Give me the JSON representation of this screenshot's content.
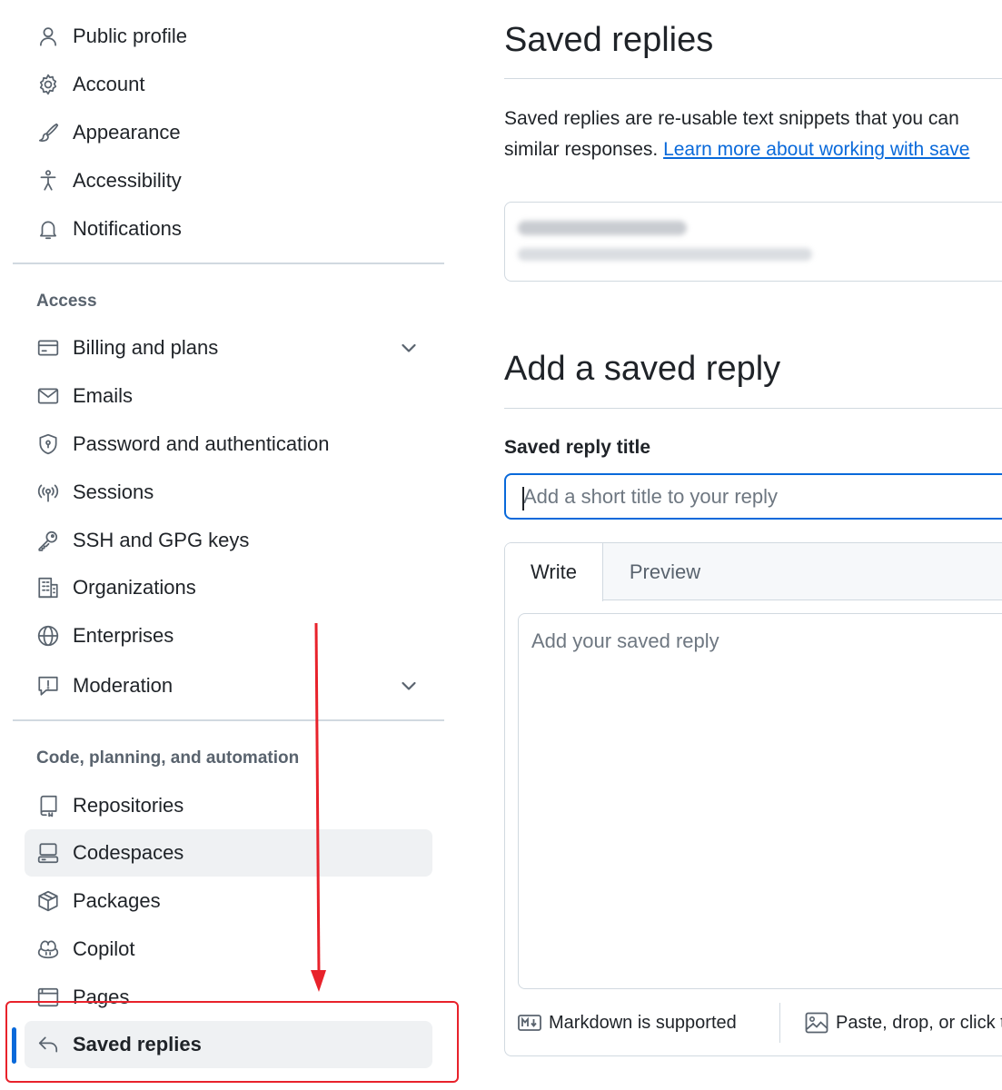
{
  "sidebar": {
    "items_top": [
      {
        "label": "Public profile",
        "icon": "person-icon"
      },
      {
        "label": "Account",
        "icon": "gear-icon"
      },
      {
        "label": "Appearance",
        "icon": "paintbrush-icon"
      },
      {
        "label": "Accessibility",
        "icon": "accessibility-icon"
      },
      {
        "label": "Notifications",
        "icon": "bell-icon"
      }
    ],
    "access": {
      "title": "Access",
      "items": [
        {
          "label": "Billing and plans",
          "icon": "credit-card-icon"
        },
        {
          "label": "Emails",
          "icon": "mail-icon"
        },
        {
          "label": "Password and authentication",
          "icon": "shield-lock-icon"
        },
        {
          "label": "Sessions",
          "icon": "broadcast-icon"
        },
        {
          "label": "SSH and GPG keys",
          "icon": "key-icon"
        },
        {
          "label": "Organizations",
          "icon": "organization-icon"
        },
        {
          "label": "Enterprises",
          "icon": "globe-icon"
        },
        {
          "label": "Moderation",
          "icon": "report-icon"
        }
      ]
    },
    "code": {
      "title": "Code, planning, and automation",
      "items": [
        {
          "label": "Repositories",
          "icon": "repo-icon"
        },
        {
          "label": "Codespaces",
          "icon": "codespaces-icon"
        },
        {
          "label": "Packages",
          "icon": "package-icon"
        },
        {
          "label": "Copilot",
          "icon": "copilot-icon"
        },
        {
          "label": "Pages",
          "icon": "browser-icon"
        },
        {
          "label": "Saved replies",
          "icon": "reply-icon"
        }
      ]
    }
  },
  "main": {
    "saved_title": "Saved replies",
    "description_text": "Saved replies are re-usable text snippets that you can",
    "description_line2": "similar responses.",
    "description_link": "Learn more about working with save",
    "add_title": "Add a saved reply",
    "field_label": "Saved reply title",
    "title_placeholder": "Add a short title to your reply",
    "tabs": {
      "write": "Write",
      "preview": "Preview"
    },
    "body_placeholder": "Add your saved reply",
    "markdown_note": "Markdown is supported",
    "paste_note": "Paste, drop, or click t"
  },
  "colors": {
    "accent": "#0969da",
    "annotation": "#e8222b",
    "selected_bg": "#eff1f3"
  }
}
